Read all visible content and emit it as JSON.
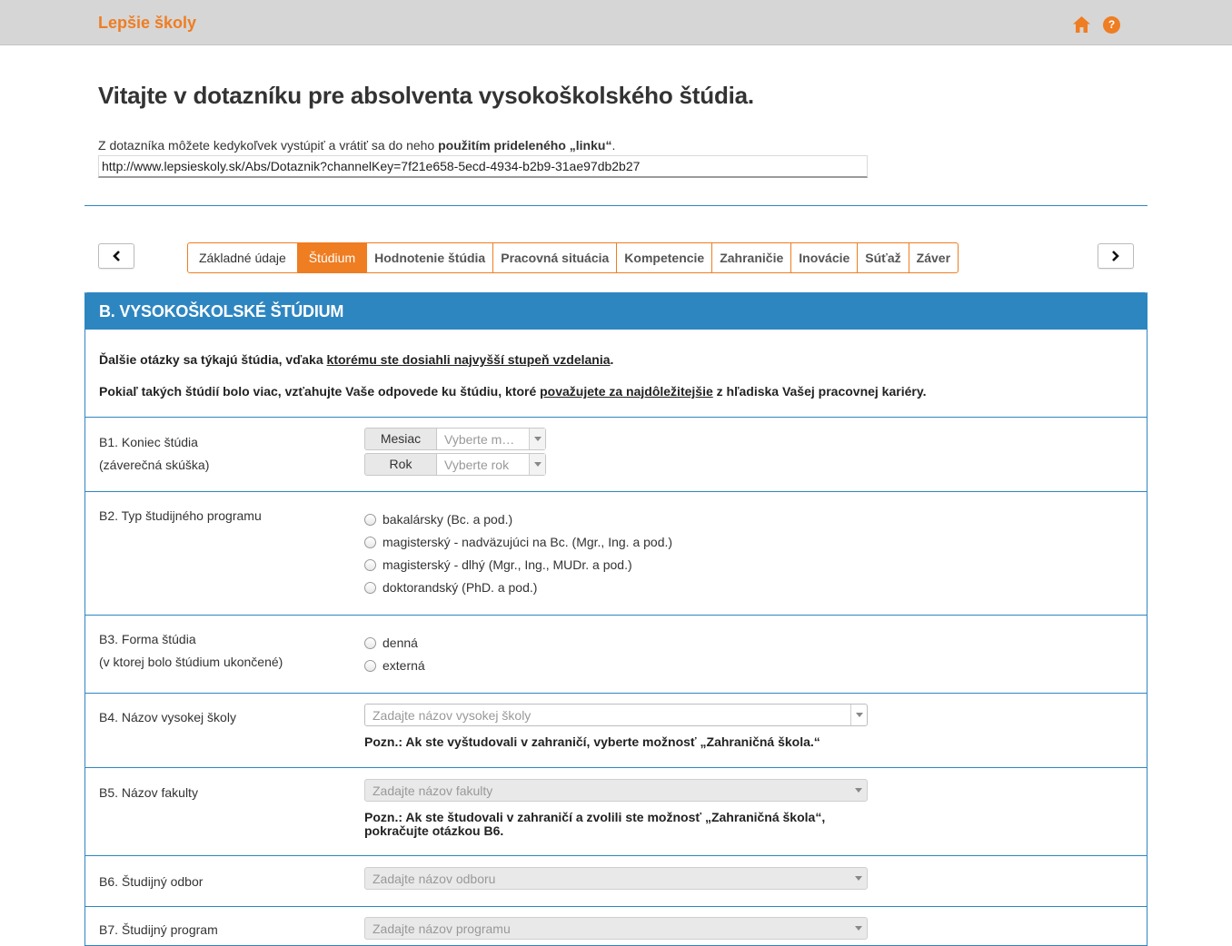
{
  "header": {
    "brand": "Lepšie školy",
    "help_glyph": "?"
  },
  "title": "Vitajte v dotazníku pre absolventa vysokoškolského štúdia.",
  "intro": {
    "text_before": "Z dotazníka môžete kedykoľvek vystúpiť a vrátiť sa do neho ",
    "text_bold": "použitím prideleného „linku“",
    "text_after": ".",
    "link_value": "http://www.lepsieskoly.sk/Abs/Dotaznik?channelKey=7f21e658-5ecd-4934-b2b9-31ae97db2b27"
  },
  "tabs": [
    "Základné údaje",
    "Štúdium",
    "Hodnotenie štúdia",
    "Pracovná situácia",
    "Kompetencie",
    "Zahraničie",
    "Inovácie",
    "Súťaž",
    "Záver"
  ],
  "active_tab": "Štúdium",
  "section": {
    "title": "B. VYSOKOŠKOLSKÉ ŠTÚDIUM",
    "p1_before": "Ďalšie otázky sa týkajú štúdia, vďaka ",
    "p1_link": "ktorému ste dosiahli najvyšší stupeň vzdelania",
    "p1_after": ".",
    "p2_before": "Pokiaľ takých štúdií bolo viac, vzťahujte Vaše odpovede ku štúdiu, ktoré ",
    "p2_link": "považujete za najdôležitejšie",
    "p2_after": " z hľadiska Vašej pracovnej kariéry."
  },
  "questions": {
    "b1": {
      "label": "B1. Koniec štúdia",
      "sub": "(záverečná skúška)",
      "month_label": "Mesiac",
      "month_placeholder": "Vyberte m…",
      "year_label": "Rok",
      "year_placeholder": "Vyberte rok"
    },
    "b2": {
      "label": "B2. Typ študijného programu",
      "options": [
        "bakalársky (Bc. a pod.)",
        "magisterský - nadväzujúci na Bc. (Mgr., Ing. a pod.)",
        "magisterský - dlhý (Mgr., Ing., MUDr. a pod.)",
        "doktorandský (PhD. a pod.)"
      ]
    },
    "b3": {
      "label": "B3. Forma štúdia",
      "sub": "(v ktorej bolo štúdium ukončené)",
      "options": [
        "denná",
        "externá"
      ]
    },
    "b4": {
      "label": "B4. Názov vysokej školy",
      "placeholder": "Zadajte názov vysokej školy",
      "note": "Pozn.: Ak ste vyštudovali v zahraničí, vyberte možnosť „Zahraničná škola.“"
    },
    "b5": {
      "label": "B5. Názov fakulty",
      "placeholder": "Zadajte názov fakulty",
      "note_line1": "Pozn.: Ak ste študovali v zahraničí a zvolili ste možnosť „Zahraničná škola“,",
      "note_line2": "pokračujte otázkou B6."
    },
    "b6": {
      "label": "B6. Študijný odbor",
      "placeholder": "Zadajte názov odboru"
    },
    "b7": {
      "label": "B7. Študijný program",
      "placeholder": "Zadajte názov programu"
    }
  },
  "colors": {
    "accent_orange": "#ef7d22",
    "panel_blue": "#2e86c1"
  },
  "icons": {
    "home": "home-icon",
    "help": "help-icon",
    "prev": "chevron-left-icon",
    "next": "chevron-right-icon"
  }
}
